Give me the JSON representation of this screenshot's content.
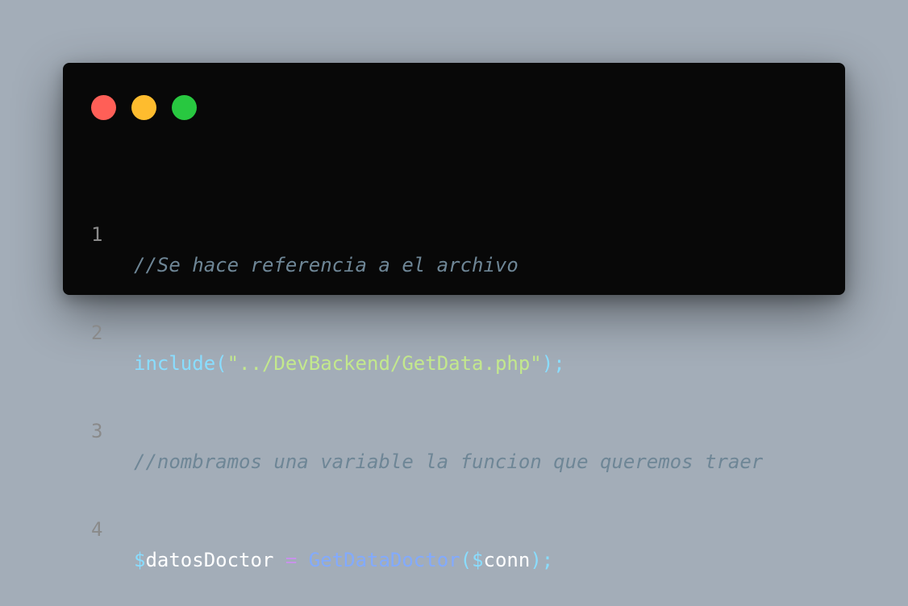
{
  "colors": {
    "background": "#a3adb8",
    "window": "#080808",
    "dot_red": "#ff5f57",
    "dot_yellow": "#febc2e",
    "dot_green": "#28c840",
    "line_number": "#8a8a8a",
    "comment": "#6e8696",
    "identifier": "#89ddff",
    "string": "#c3e88d",
    "punctuation": "#89ddff",
    "variable": "#ffffff",
    "operator": "#c792ea",
    "function": "#82aaff"
  },
  "window_controls": {
    "close": "close-dot",
    "minimize": "minimize-dot",
    "maximize": "maximize-dot"
  },
  "code": {
    "lines": [
      {
        "number": "1",
        "comment": "//Se hace referencia a el archivo"
      },
      {
        "number": "2",
        "keyword": "include",
        "open": "(",
        "string": "\"../DevBackend/GetData.php\"",
        "close": ");"
      },
      {
        "number": "3",
        "comment": "//nombramos una variable la funcion que queremos traer"
      },
      {
        "number": "4",
        "var_sigil": "$",
        "var_name": "datosDoctor",
        "space1": " ",
        "operator": "=",
        "space2": " ",
        "function": "GetDataDoctor",
        "open": "(",
        "arg_sigil": "$",
        "arg_name": "conn",
        "close": ");"
      }
    ]
  }
}
